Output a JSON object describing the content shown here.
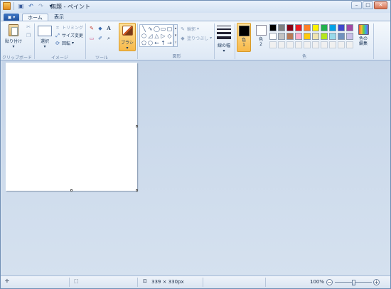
{
  "window": {
    "title": "無題 - ペイント",
    "controls": {
      "minimize": "–",
      "maximize": "□",
      "close": "✕"
    }
  },
  "quick_access": {
    "app_icon": "paint-icon",
    "save_icon": "save-icon",
    "undo_icon": "undo-icon",
    "redo_icon": "redo-icon",
    "dropdown": "▾"
  },
  "tabs": {
    "menu_button": "▣ ▾",
    "items": [
      {
        "label": "ホーム",
        "active": true
      },
      {
        "label": "表示",
        "active": false
      }
    ]
  },
  "ribbon": {
    "clipboard": {
      "group_label": "クリップボード",
      "paste_label": "貼り付け",
      "cut_icon": "✂",
      "copy_icon": "❐"
    },
    "image": {
      "group_label": "イメージ",
      "select_label": "選択",
      "crop_label": "トリミング",
      "resize_label": "サイズ変更",
      "rotate_label": "回転"
    },
    "tools": {
      "group_label": "ツール",
      "pencil": "✎",
      "fill": "◆",
      "text": "A",
      "eraser": "▭",
      "picker": "✐",
      "magnifier": "⌕"
    },
    "brush": {
      "label": "ブラシ"
    },
    "shapes": {
      "group_label": "図形",
      "outline_label": "輪郭",
      "fill_label": "塗りつぶし",
      "items": [
        "╲",
        "∿",
        "◯",
        "▭",
        "▢",
        "⬡",
        "◿",
        "△",
        "▷",
        "◇",
        "⬠",
        "⬡",
        "←",
        "↑",
        "→"
      ]
    },
    "width": {
      "label": "線の幅"
    },
    "colors": {
      "group_label": "色",
      "color1_label": "色\n1",
      "color2_label": "色\n2",
      "color1": "#000000",
      "color2": "#ffffff",
      "edit_label": "色の\n編集",
      "palette": [
        "#000000",
        "#7f7f7f",
        "#880015",
        "#ed1c24",
        "#ff7f27",
        "#fff200",
        "#22b14c",
        "#00a2e8",
        "#3f48cc",
        "#a349a4",
        "#ffffff",
        "#c3c3c3",
        "#b97a57",
        "#ffaec9",
        "#ffc90e",
        "#efe4b0",
        "#b5e61d",
        "#99d9ea",
        "#7092be",
        "#c8bfe7",
        "#f0f0f0",
        "#f0f0f0",
        "#f0f0f0",
        "#f0f0f0",
        "#f0f0f0",
        "#f0f0f0",
        "#f0f0f0",
        "#f0f0f0",
        "#f0f0f0",
        "#f0f0f0"
      ]
    }
  },
  "statusbar": {
    "cursor_icon": "✛",
    "selection_icon": "⬚",
    "size_icon": "⊡",
    "canvas_size": "339 × 330px",
    "zoom": "100%",
    "zoom_out": "−",
    "zoom_in": "+"
  }
}
